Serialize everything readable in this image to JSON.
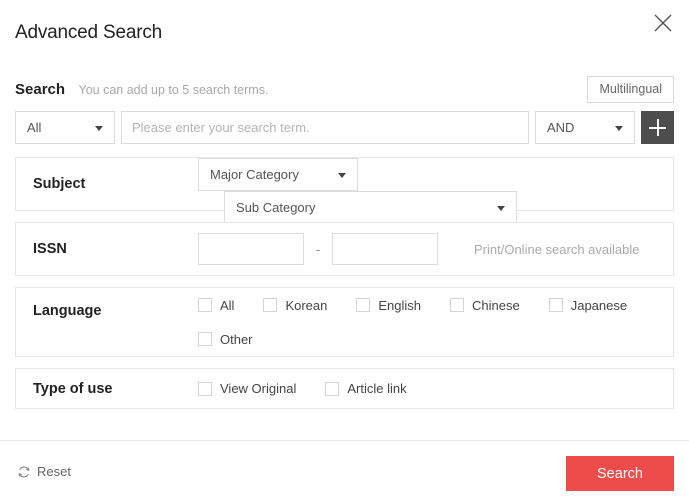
{
  "modal": {
    "title": "Advanced Search",
    "close_icon": "close-icon"
  },
  "search_section": {
    "label": "Search",
    "hint": "You can add up to 5 search terms.",
    "multilingual_label": "Multilingual",
    "term_row": {
      "field_select": "All",
      "term_placeholder": "Please enter your search term.",
      "term_value": "",
      "operator_select": "AND",
      "add_icon": "plus-icon"
    }
  },
  "filters": [
    {
      "key": "subject",
      "label": "Subject",
      "major_category": "Major Category",
      "sub_category": "Sub Category"
    },
    {
      "key": "issn",
      "label": "ISSN",
      "from_value": "",
      "to_value": "",
      "separator": "-",
      "note": "Print/Online search available"
    },
    {
      "key": "language",
      "label": "Language",
      "options_row1": [
        "All",
        "Korean",
        "English",
        "Chinese",
        "Japanese"
      ],
      "options_row2": [
        "Other"
      ]
    },
    {
      "key": "type_of_use",
      "label": "Type of use",
      "options": [
        "View Original",
        "Article link"
      ]
    }
  ],
  "footer": {
    "reset_label": "Reset",
    "reset_icon": "refresh-icon",
    "search_label": "Search"
  },
  "colors": {
    "accent_red": "#ee4b4b",
    "add_button_dark": "#4d4d4d",
    "border_gray": "#e6e6e6",
    "hint_gray": "#a8a8a8"
  }
}
